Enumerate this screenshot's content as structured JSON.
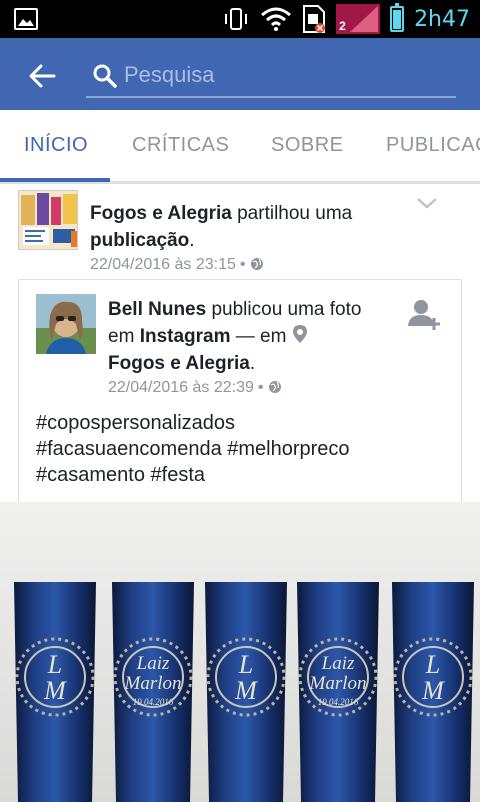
{
  "status_bar": {
    "time": "2h47",
    "sim_number": "2",
    "battery_level": 0.85
  },
  "app_bar": {
    "search_placeholder": "Pesquisa"
  },
  "tabs": [
    {
      "label": "INÍCIO",
      "active": true
    },
    {
      "label": "CRÍTICAS",
      "active": false
    },
    {
      "label": "SOBRE",
      "active": false
    },
    {
      "label": "PUBLICAÇ",
      "active": false
    }
  ],
  "share": {
    "page_name": "Fogos e Alegria",
    "action": " partilhou uma ",
    "object": "publicação",
    "period": ".",
    "date": "22/04/2016 às 23:15",
    "dot": "•"
  },
  "post": {
    "author": "Bell Nunes",
    "action1": " publicou uma foto em ",
    "source": "Instagram",
    "action2": " — em ",
    "location": "Fogos e Alegria",
    "period": ".",
    "date": "22/04/2016 às 22:39",
    "dot": "•",
    "hashtags_line1": "#copospersonalizados",
    "hashtags_line2": "#facasuaencomenda #melhorpreco",
    "hashtags_line3": "#casamento #festa"
  },
  "photo": {
    "cup_monograms": [
      "L M",
      "Laiz Marlon 19.04.2016",
      "L M",
      "Laiz Marlon 19.04.2016",
      "L M"
    ]
  },
  "colors": {
    "brand": "#4267b2",
    "status_accent": "#5fd7f0"
  }
}
